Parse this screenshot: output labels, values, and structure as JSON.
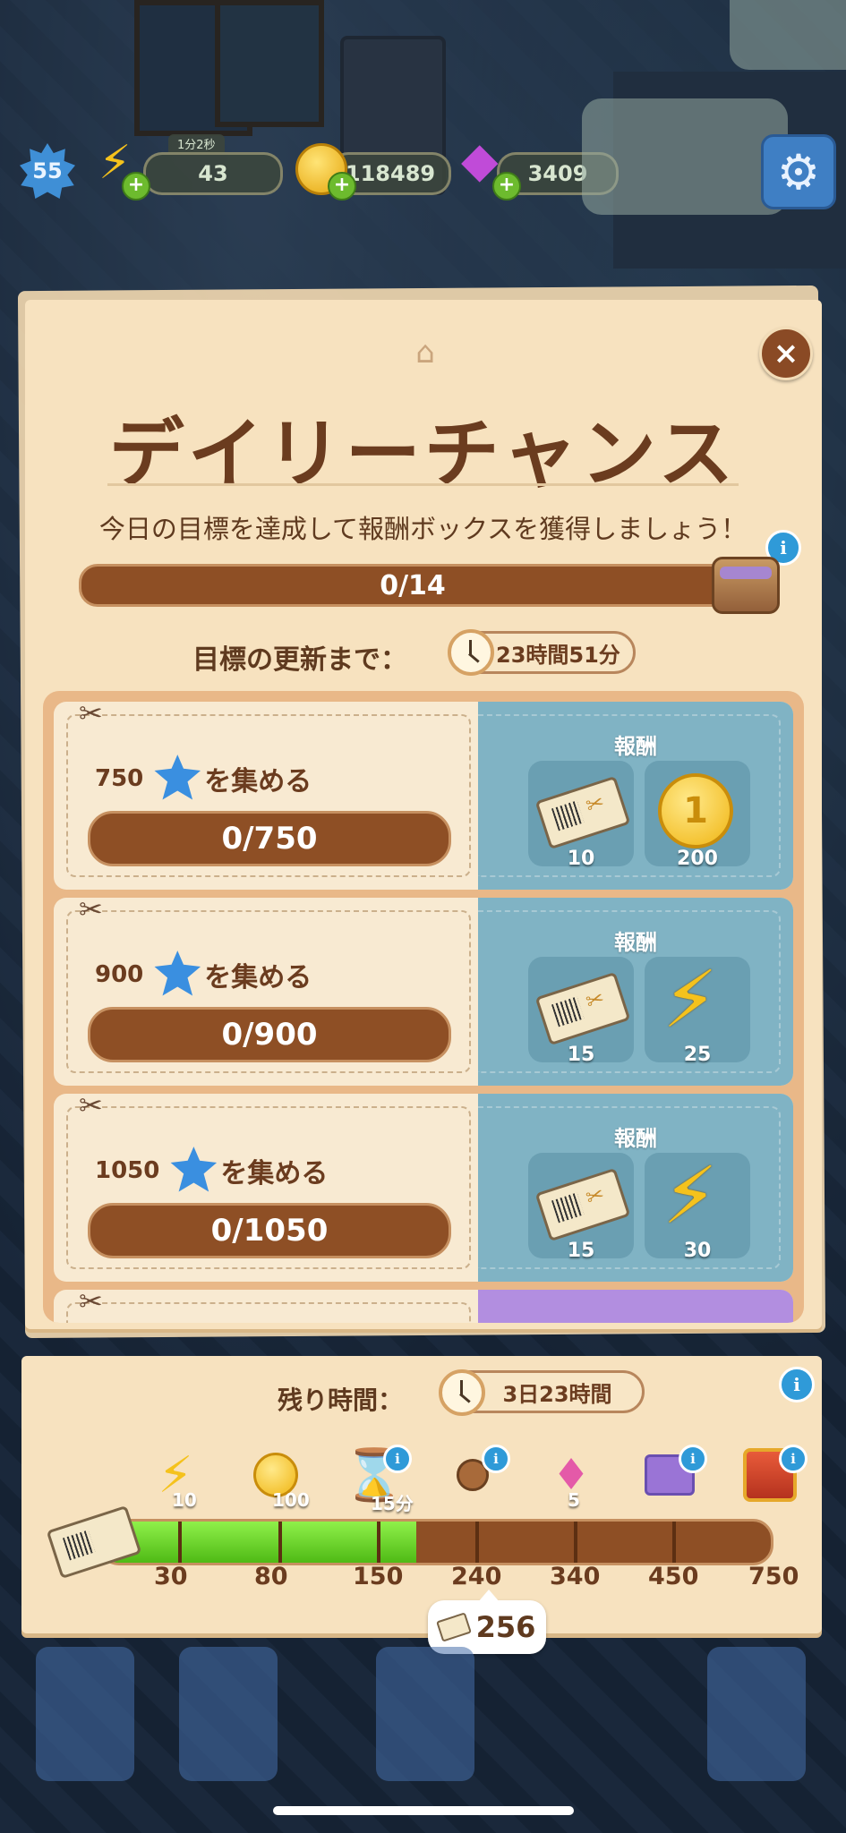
{
  "hud": {
    "level": "55",
    "energy_timer": "1分2秒",
    "energy": "43",
    "coins": "118489",
    "gems": "3409",
    "plus": "+"
  },
  "panel": {
    "title": "デイリーチャンス",
    "subtitle": "今日の目標を達成して報酬ボックスを獲得しましょう！",
    "progress": "0/14",
    "refresh_label": "目標の更新まで：",
    "refresh_time": "23時間51分",
    "close": "×",
    "info": "i"
  },
  "tasks": [
    {
      "amount": "750",
      "suffix": "を集める",
      "progress": "0/750",
      "reward_label": "報酬",
      "rewards": [
        {
          "icon": "ticket-icon",
          "value": "10"
        },
        {
          "icon": "coin-icon",
          "value": "200"
        }
      ]
    },
    {
      "amount": "900",
      "suffix": "を集める",
      "progress": "0/900",
      "reward_label": "報酬",
      "rewards": [
        {
          "icon": "ticket-icon",
          "value": "15"
        },
        {
          "icon": "lightning-icon",
          "value": "25"
        }
      ]
    },
    {
      "amount": "1050",
      "suffix": "を集める",
      "progress": "0/1050",
      "reward_label": "報酬",
      "rewards": [
        {
          "icon": "ticket-icon",
          "value": "15"
        },
        {
          "icon": "lightning-icon",
          "value": "30"
        }
      ]
    }
  ],
  "event": {
    "remaining_label": "残り時間：",
    "remaining_time": "3日23時間",
    "ticket_count": "256",
    "progress_fraction": 0.47,
    "milestones": [
      {
        "threshold": "30",
        "icon": "lightning-icon",
        "value": "10"
      },
      {
        "threshold": "80",
        "icon": "coin-icon",
        "value": "100"
      },
      {
        "threshold": "150",
        "icon": "hourglass-icon",
        "value": "15分"
      },
      {
        "threshold": "240",
        "icon": "pin-icon",
        "value": ""
      },
      {
        "threshold": "340",
        "icon": "gem-icon",
        "value": "5"
      },
      {
        "threshold": "450",
        "icon": "gift-box-icon",
        "value": ""
      },
      {
        "threshold": "750",
        "icon": "treasure-chest-icon",
        "value": ""
      }
    ]
  },
  "colors": {
    "panel_bg": "#f7e2bf",
    "title_brown": "#6b3c1f",
    "bar_brown": "#8e4f25",
    "reward_blue": "#80b3c4",
    "progress_green": "#4fba15",
    "info_blue": "#2f9ad8"
  }
}
